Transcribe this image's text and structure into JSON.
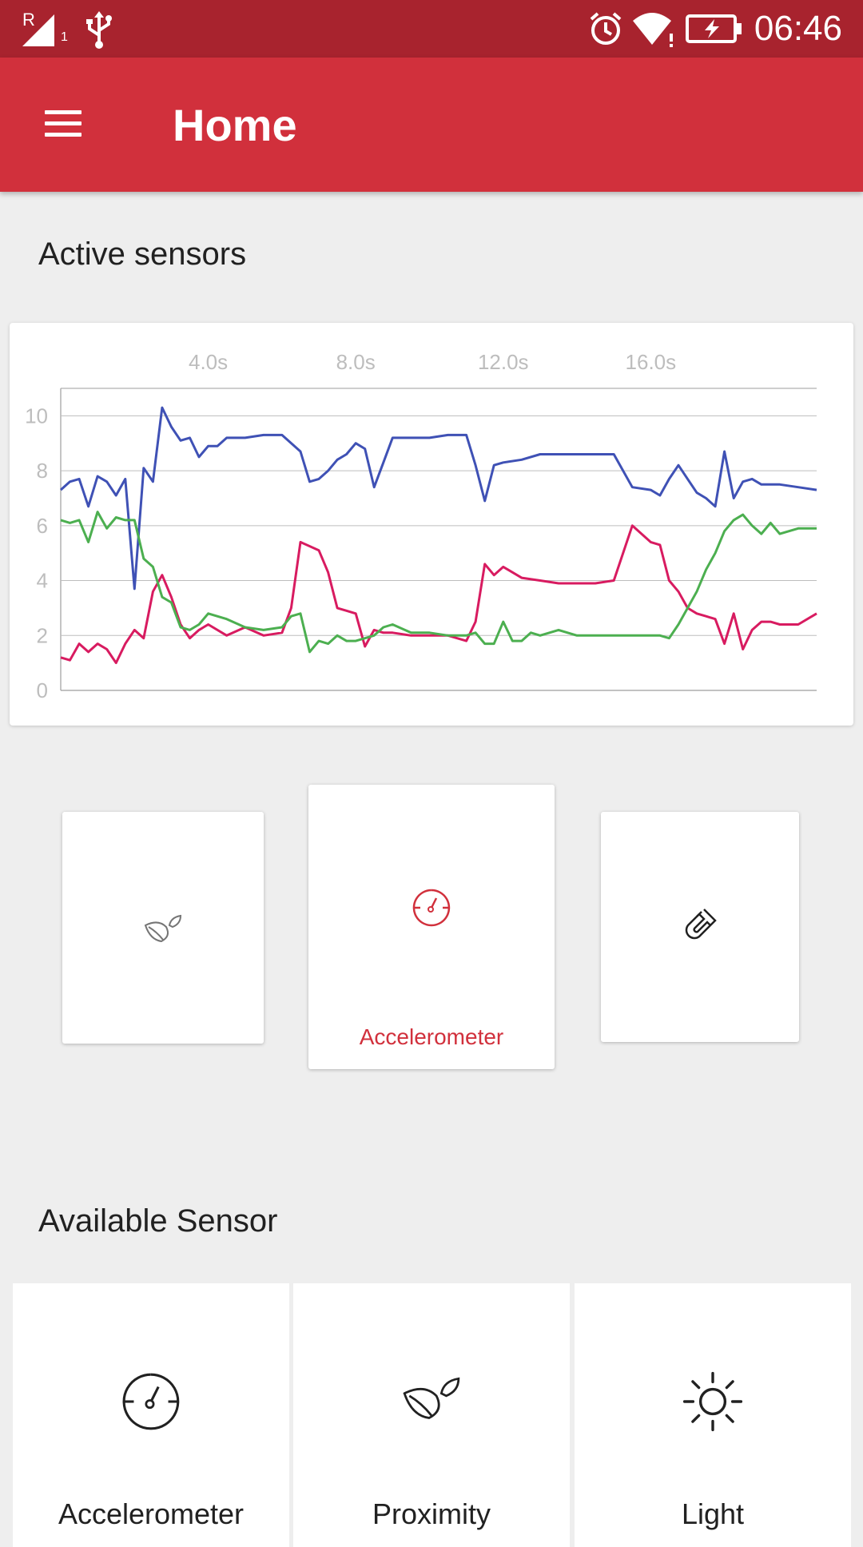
{
  "status_bar": {
    "time": "06:46",
    "roaming_indicator": "R",
    "sim_slot": "1",
    "icons": [
      "signal-icon",
      "usb-icon",
      "alarm-icon",
      "wifi-icon",
      "battery-charging-icon"
    ]
  },
  "app_bar": {
    "title": "Home",
    "menu_icon": "menu-icon"
  },
  "active_section": {
    "title": "Active sensors"
  },
  "chart_data": {
    "type": "line",
    "x_tick_labels": [
      "4.0s",
      "8.0s",
      "12.0s",
      "16.0s"
    ],
    "x_ticks": [
      4.0,
      8.0,
      12.0,
      16.0
    ],
    "xlim": [
      0,
      20.5
    ],
    "ylim": [
      0,
      11
    ],
    "y_ticks": [
      0,
      2,
      4,
      6,
      8,
      10
    ],
    "grid": true,
    "series": [
      {
        "color": "#3f51b5",
        "x": [
          0,
          0.25,
          0.5,
          0.75,
          1.0,
          1.25,
          1.5,
          1.75,
          2.0,
          2.25,
          2.5,
          2.75,
          3.0,
          3.25,
          3.5,
          3.75,
          4.0,
          4.25,
          4.5,
          5.0,
          5.5,
          6.0,
          6.5,
          6.75,
          7.0,
          7.25,
          7.5,
          7.75,
          8.0,
          8.25,
          8.5,
          8.75,
          9.0,
          9.25,
          9.5,
          10.0,
          10.5,
          11.0,
          11.25,
          11.5,
          11.75,
          12.0,
          12.5,
          13.0,
          13.5,
          14.0,
          14.5,
          15.0,
          15.5,
          16.0,
          16.25,
          16.5,
          16.75,
          17.0,
          17.25,
          17.5,
          17.75,
          18.0,
          18.25,
          18.5,
          18.75,
          19.0,
          19.25,
          19.5,
          20.0,
          20.5
        ],
        "values": [
          7.3,
          7.6,
          7.7,
          6.7,
          7.8,
          7.6,
          7.1,
          7.7,
          3.7,
          8.1,
          7.6,
          10.3,
          9.6,
          9.1,
          9.2,
          8.5,
          8.9,
          8.9,
          9.2,
          9.2,
          9.3,
          9.3,
          8.7,
          7.6,
          7.7,
          8.0,
          8.4,
          8.6,
          9.0,
          8.8,
          7.4,
          8.3,
          9.2,
          9.2,
          9.2,
          9.2,
          9.3,
          9.3,
          8.2,
          6.9,
          8.2,
          8.3,
          8.4,
          8.6,
          8.6,
          8.6,
          8.6,
          8.6,
          7.4,
          7.3,
          7.1,
          7.7,
          8.2,
          7.7,
          7.2,
          7.0,
          6.7,
          8.7,
          7.0,
          7.6,
          7.7,
          7.5,
          7.5,
          7.5,
          7.4,
          7.3
        ]
      },
      {
        "color": "#d81b60",
        "x": [
          0,
          0.25,
          0.5,
          0.75,
          1.0,
          1.25,
          1.5,
          1.75,
          2.0,
          2.25,
          2.5,
          2.75,
          3.0,
          3.25,
          3.5,
          3.75,
          4.0,
          4.5,
          5.0,
          5.5,
          6.0,
          6.25,
          6.5,
          7.0,
          7.25,
          7.5,
          7.75,
          8.0,
          8.25,
          8.5,
          8.75,
          9.0,
          9.5,
          10.0,
          10.5,
          11.0,
          11.25,
          11.5,
          11.75,
          12.0,
          12.5,
          13.0,
          13.5,
          14.0,
          14.5,
          15.0,
          15.5,
          16.0,
          16.25,
          16.5,
          16.75,
          17.0,
          17.25,
          17.5,
          17.75,
          18.0,
          18.25,
          18.5,
          18.75,
          19.0,
          19.25,
          19.5,
          20.0,
          20.5
        ],
        "values": [
          1.2,
          1.1,
          1.7,
          1.4,
          1.7,
          1.5,
          1.0,
          1.7,
          2.2,
          1.9,
          3.6,
          4.2,
          3.4,
          2.4,
          1.9,
          2.2,
          2.4,
          2.0,
          2.3,
          2.0,
          2.1,
          3.0,
          5.4,
          5.1,
          4.3,
          3.0,
          2.9,
          2.8,
          1.6,
          2.2,
          2.1,
          2.1,
          2.0,
          2.0,
          2.0,
          1.8,
          2.5,
          4.6,
          4.2,
          4.5,
          4.1,
          4.0,
          3.9,
          3.9,
          3.9,
          4.0,
          6.0,
          5.4,
          5.3,
          4.0,
          3.6,
          3.0,
          2.8,
          2.7,
          2.6,
          1.7,
          2.8,
          1.5,
          2.2,
          2.5,
          2.5,
          2.4,
          2.4,
          2.8
        ]
      },
      {
        "color": "#4caf50",
        "x": [
          0,
          0.25,
          0.5,
          0.75,
          1.0,
          1.25,
          1.5,
          1.75,
          2.0,
          2.25,
          2.5,
          2.75,
          3.0,
          3.25,
          3.5,
          3.75,
          4.0,
          4.5,
          5.0,
          5.5,
          6.0,
          6.25,
          6.5,
          6.75,
          7.0,
          7.25,
          7.5,
          7.75,
          8.0,
          8.5,
          8.75,
          9.0,
          9.5,
          10.0,
          10.5,
          11.0,
          11.25,
          11.5,
          11.75,
          12.0,
          12.25,
          12.5,
          12.75,
          13.0,
          13.5,
          14.0,
          14.5,
          15.0,
          15.5,
          16.0,
          16.25,
          16.5,
          16.75,
          17.0,
          17.25,
          17.5,
          17.75,
          18.0,
          18.25,
          18.5,
          18.75,
          19.0,
          19.25,
          19.5,
          20.0,
          20.5
        ],
        "values": [
          6.2,
          6.1,
          6.2,
          5.4,
          6.5,
          5.9,
          6.3,
          6.2,
          6.2,
          4.8,
          4.5,
          3.4,
          3.2,
          2.3,
          2.2,
          2.4,
          2.8,
          2.6,
          2.3,
          2.2,
          2.3,
          2.7,
          2.8,
          1.4,
          1.8,
          1.7,
          2.0,
          1.8,
          1.8,
          2.0,
          2.3,
          2.4,
          2.1,
          2.1,
          2.0,
          2.0,
          2.1,
          1.7,
          1.7,
          2.5,
          1.8,
          1.8,
          2.1,
          2.0,
          2.2,
          2.0,
          2.0,
          2.0,
          2.0,
          2.0,
          2.0,
          1.9,
          2.4,
          3.0,
          3.6,
          4.4,
          5.0,
          5.8,
          6.2,
          6.4,
          6.0,
          5.7,
          6.1,
          5.7,
          5.9,
          5.9
        ]
      }
    ]
  },
  "active_cards": [
    {
      "icon": "leaf-icon",
      "label": ""
    },
    {
      "icon": "speedometer-icon",
      "label": "Accelerometer"
    },
    {
      "icon": "magnet-icon",
      "label": ""
    }
  ],
  "available_section": {
    "title": "Available Sensor"
  },
  "available_sensors": [
    {
      "icon": "speedometer-icon",
      "label": "Accelerometer"
    },
    {
      "icon": "leaf-icon",
      "label": "Proximity"
    },
    {
      "icon": "sun-icon",
      "label": "Light"
    }
  ],
  "colors": {
    "status_bar": "#a8232e",
    "app_bar": "#d1303c",
    "accent": "#d1303c",
    "background": "#eeeeee"
  }
}
